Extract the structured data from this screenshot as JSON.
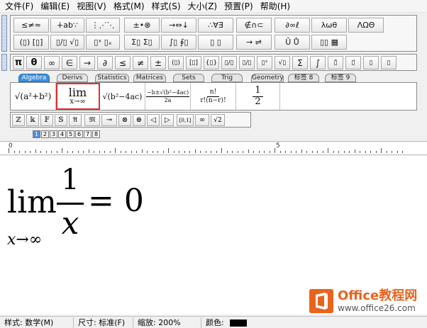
{
  "menubar": [
    "文件(F)",
    "编辑(E)",
    "视图(V)",
    "格式(M)",
    "样式(S)",
    "大小(Z)",
    "预置(P)",
    "帮助(H)"
  ],
  "toolbar": {
    "row1": [
      "≤≠≈",
      "∔ab∵",
      "⋮⋰⋱",
      "±•⊗",
      "→⇔↓",
      "∴∀∃",
      "∉∩⊂",
      "∂∞ℓ",
      "λωθ",
      "ΛΩΘ"
    ],
    "row2": [
      "(▯) [▯]",
      "▯/▯ √▯",
      "▯ˣ ▯ₓ",
      "Σ▯ Σ▯",
      "∫▯ ∮▯",
      "▯ ▯",
      "→ ⇌",
      "Ū Ů",
      "▯▯ ▦"
    ],
    "row3": [
      "π",
      "θ",
      "∞",
      "∈",
      "→",
      "∂",
      "≤",
      "≠",
      "±",
      "(▯)",
      "[▯]",
      "{▯}",
      "▯/▯",
      "▯/▯",
      "▯ˣ",
      "√▯",
      "Σ",
      "∫",
      "▯̄",
      "▯⃗",
      "▯",
      "▯"
    ]
  },
  "tabs": [
    "Algebra",
    "Derivs",
    "Statistics",
    "Matrices",
    "Sets",
    "Trig",
    "Geometry",
    "标签 8",
    "标签 9"
  ],
  "templates": {
    "t1": "√(a²+b²)",
    "t2_top": "lim",
    "t2_bottom": "x→∞",
    "t3": "√(b²−4ac)",
    "t4_num": "−b±√(b²−4ac)",
    "t4_den": "2a",
    "t5_num": "n!",
    "t5_den": "r!(n−r)!",
    "t6_num": "1",
    "t6_den": "2"
  },
  "symbols": [
    "ℤ",
    "𝕜",
    "𝔽",
    "𝕊",
    "𝔄",
    "𝔐",
    "⊸",
    "⊗",
    "⊕",
    "◁",
    "▷",
    "[0,1]",
    "∞",
    "√2"
  ],
  "nav": [
    "1",
    "2",
    "3",
    "4",
    "5",
    "6",
    "7",
    "8"
  ],
  "ruler": {
    "start": "0",
    "mid": "5"
  },
  "formula": {
    "lim": "lim",
    "sub": "x→∞",
    "num": "1",
    "den": "x",
    "rhs": "= 0"
  },
  "status": {
    "style": "样式: 数学(M)",
    "size": "尺寸: 标准(F)",
    "zoom": "缩放: 200%",
    "color": "颜色:"
  },
  "watermark": {
    "title": "Office教程网",
    "url": "www.office26.com"
  }
}
